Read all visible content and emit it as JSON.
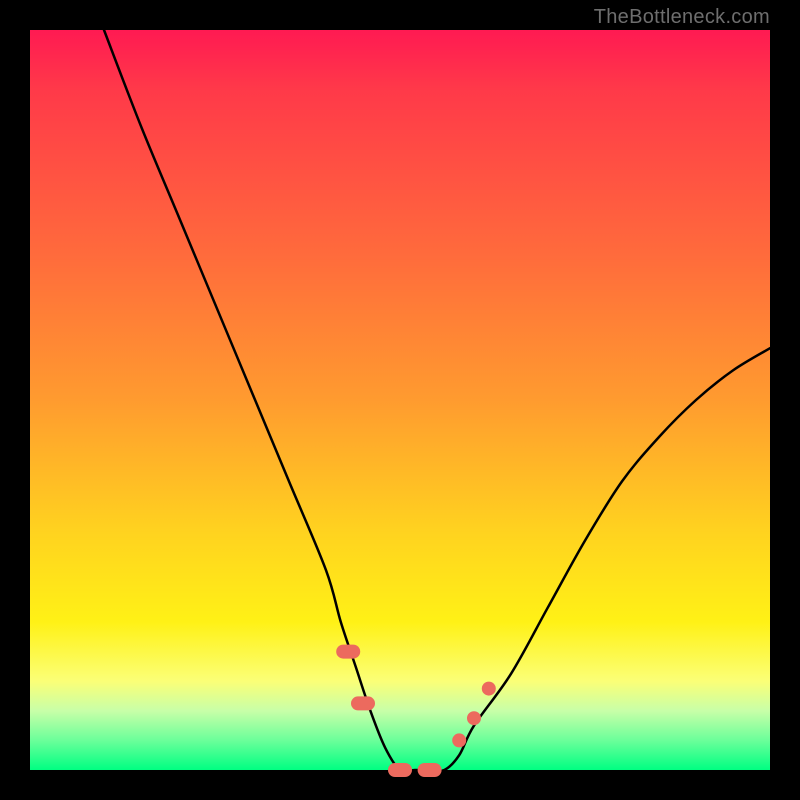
{
  "watermark": "TheBottleneck.com",
  "chart_data": {
    "type": "line",
    "title": "",
    "xlabel": "",
    "ylabel": "",
    "xlim": [
      0,
      100
    ],
    "ylim": [
      0,
      100
    ],
    "grid": false,
    "series": [
      {
        "name": "bottleneck-curve",
        "color": "#000000",
        "x": [
          10,
          15,
          20,
          25,
          30,
          35,
          40,
          42,
          44,
          46,
          48,
          50,
          52,
          54,
          56,
          58,
          60,
          65,
          70,
          75,
          80,
          85,
          90,
          95,
          100
        ],
        "y": [
          100,
          87,
          75,
          63,
          51,
          39,
          27,
          20,
          14,
          8,
          3,
          0,
          0,
          0,
          0,
          2,
          6,
          13,
          22,
          31,
          39,
          45,
          50,
          54,
          57
        ]
      }
    ],
    "markers": [
      {
        "name": "left-cluster-1",
        "x": 43,
        "y": 16,
        "shape": "pill",
        "color": "#ec6a5e"
      },
      {
        "name": "left-cluster-2",
        "x": 45,
        "y": 9,
        "shape": "pill",
        "color": "#ec6a5e"
      },
      {
        "name": "floor-1",
        "x": 50,
        "y": 0,
        "shape": "pill",
        "color": "#ec6a5e"
      },
      {
        "name": "floor-2",
        "x": 54,
        "y": 0,
        "shape": "pill",
        "color": "#ec6a5e"
      },
      {
        "name": "right-cluster-1",
        "x": 58,
        "y": 4,
        "shape": "dot",
        "color": "#ec6a5e"
      },
      {
        "name": "right-cluster-2",
        "x": 60,
        "y": 7,
        "shape": "dot",
        "color": "#ec6a5e"
      },
      {
        "name": "right-cluster-3",
        "x": 62,
        "y": 11,
        "shape": "dot",
        "color": "#ec6a5e"
      }
    ]
  }
}
